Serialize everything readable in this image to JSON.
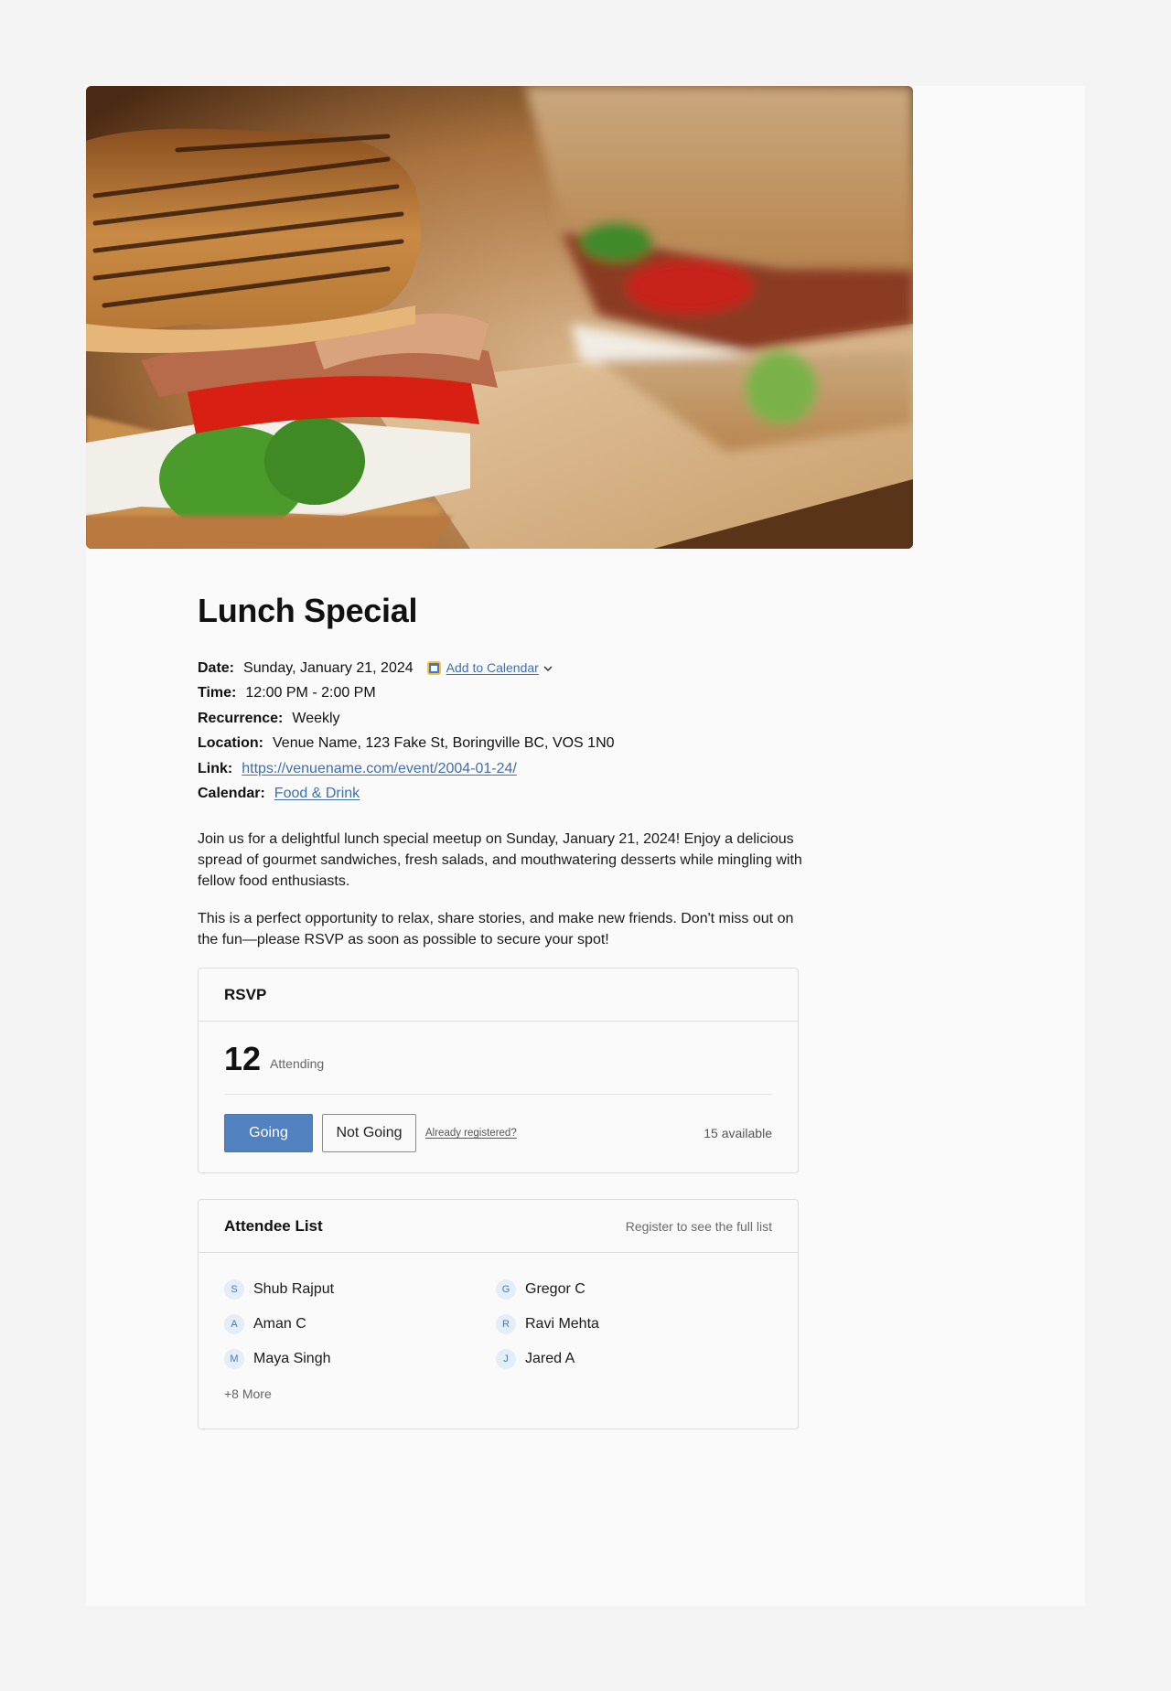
{
  "event": {
    "title": "Lunch Special",
    "hero_alt": "Grilled BLT sandwich on toasted bread"
  },
  "meta": {
    "date_label": "Date:",
    "date_value": "Sunday, January 21, 2024",
    "add_to_calendar": "Add to Calendar",
    "time_label": "Time:",
    "time_value": "12:00 PM - 2:00 PM",
    "recurrence_label": "Recurrence:",
    "recurrence_value": "Weekly",
    "location_label": "Location:",
    "location_value": "Venue Name, 123 Fake St, Boringville BC, VOS 1N0",
    "link_label": "Link:",
    "link_value": "https://venuename.com/event/2004-01-24/",
    "calendar_label": "Calendar:",
    "calendar_value": "Food & Drink"
  },
  "description": [
    "Join us for a delightful lunch special meetup on Sunday, January 21, 2024! Enjoy a delicious spread of gourmet sandwiches, fresh salads, and mouthwatering desserts while mingling with fellow food enthusiasts.",
    "This is a perfect opportunity to relax, share stories, and make new friends. Don't miss out on the fun—please RSVP as soon as possible to secure your spot!"
  ],
  "rsvp": {
    "title": "RSVP",
    "count": "12",
    "count_label": "Attending",
    "going_label": "Going",
    "not_going_label": "Not Going",
    "already_registered": "Already registered?",
    "available": "15 available"
  },
  "attendees": {
    "title": "Attendee List",
    "hint": "Register to see the full list",
    "list": [
      {
        "initial": "S",
        "name": "Shub Rajput"
      },
      {
        "initial": "G",
        "name": "Gregor C"
      },
      {
        "initial": "A",
        "name": "Aman C"
      },
      {
        "initial": "R",
        "name": "Ravi Mehta"
      },
      {
        "initial": "M",
        "name": "Maya Singh"
      },
      {
        "initial": "J",
        "name": "Jared A"
      }
    ],
    "more": "+8 More"
  },
  "colors": {
    "accent": "#5182bf",
    "link": "#3d6fb4",
    "avatar_bg": "#e3eef9"
  }
}
